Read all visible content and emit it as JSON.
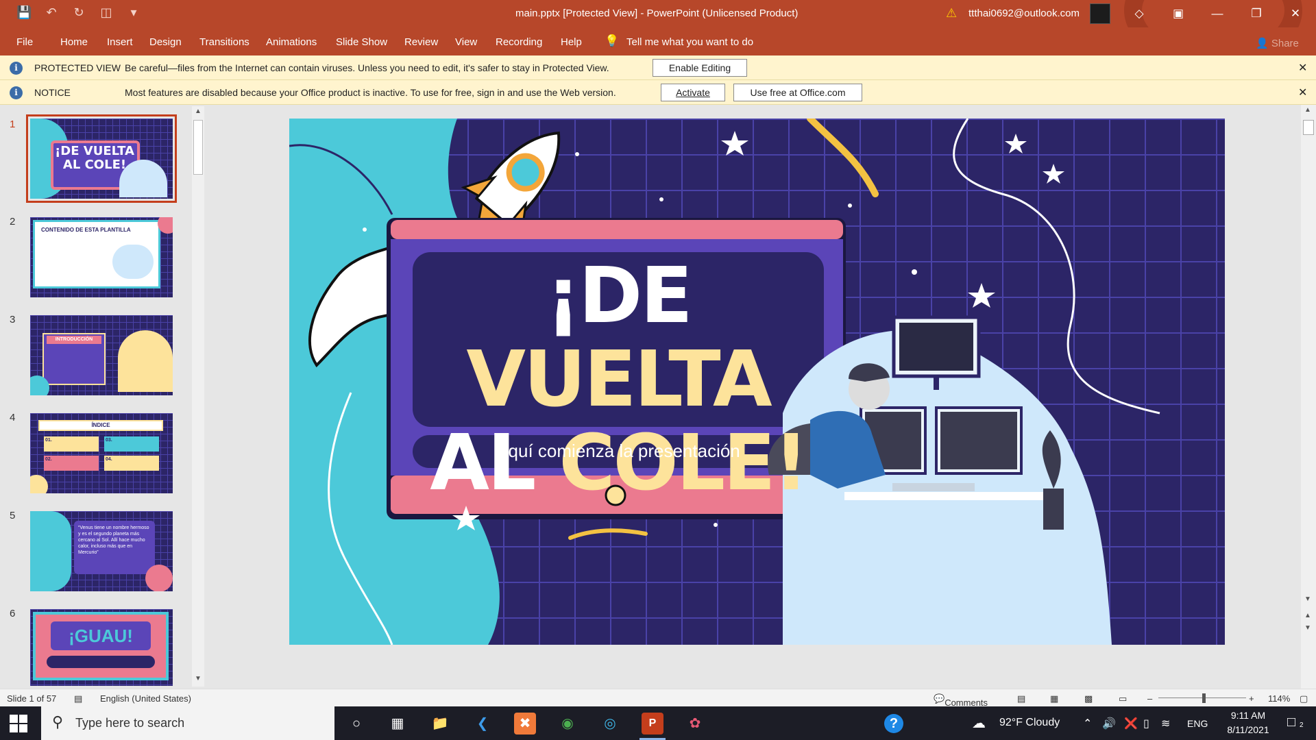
{
  "window": {
    "title": "main.pptx [Protected View]  -  PowerPoint (Unlicensed Product)",
    "account": "ttthai0692@outlook.com"
  },
  "ribbon": {
    "tabs": [
      "File",
      "Home",
      "Insert",
      "Design",
      "Transitions",
      "Animations",
      "Slide Show",
      "Review",
      "View",
      "Recording",
      "Help"
    ],
    "tell_me": "Tell me what you want to do",
    "share": "Share"
  },
  "protected_bar": {
    "label": "PROTECTED VIEW",
    "message": "Be careful—files from the Internet can contain viruses. Unless you need to edit, it's safer to stay in Protected View.",
    "button": "Enable Editing"
  },
  "notice_bar": {
    "label": "NOTICE",
    "message": "Most features are disabled because your Office product is inactive. To use for free, sign in and use the Web version.",
    "activate": "Activate",
    "use_free": "Use free at Office.com"
  },
  "thumbnails": [
    {
      "num": "1",
      "text": "¡DE VUELTA AL COLE!"
    },
    {
      "num": "2",
      "text": "CONTENIDO DE ESTA PLANTILLA"
    },
    {
      "num": "3",
      "text": "INTRODUCCIÓN"
    },
    {
      "num": "4",
      "text": "ÍNDICE",
      "items": [
        "01.",
        "02.",
        "03.",
        "04."
      ]
    },
    {
      "num": "5",
      "text": "“Venus tiene un nombre hermoso y es el segundo planeta más cercano al Sol. Allí hace mucho calor, incluso más que en Mercurio”"
    },
    {
      "num": "6",
      "text": "¡GUAU!"
    }
  ],
  "slide": {
    "title_white_1": "¡DE ",
    "title_yellow_1": "VUELTA",
    "title_white_2": "AL ",
    "title_yellow_2": "COLE!",
    "subtitle": "Aquí comienza la presentación"
  },
  "status": {
    "slide_counter": "Slide 1 of 57",
    "language": "English (United States)",
    "comments": "Comments",
    "zoom": "114%"
  },
  "taskbar": {
    "search_placeholder": "Type here to search",
    "weather": "92°F  Cloudy",
    "lang": "ENG",
    "time": "9:11 AM",
    "date": "8/11/2021",
    "notifications": "2"
  },
  "colors": {
    "ribbon": "#b7472a",
    "slide_bg": "#2c2567",
    "grid": "#4a42a8",
    "cyan": "#4cc9d9",
    "pink": "#eb7a8f",
    "yellow": "#fde39b",
    "purple": "#5b45b8"
  }
}
